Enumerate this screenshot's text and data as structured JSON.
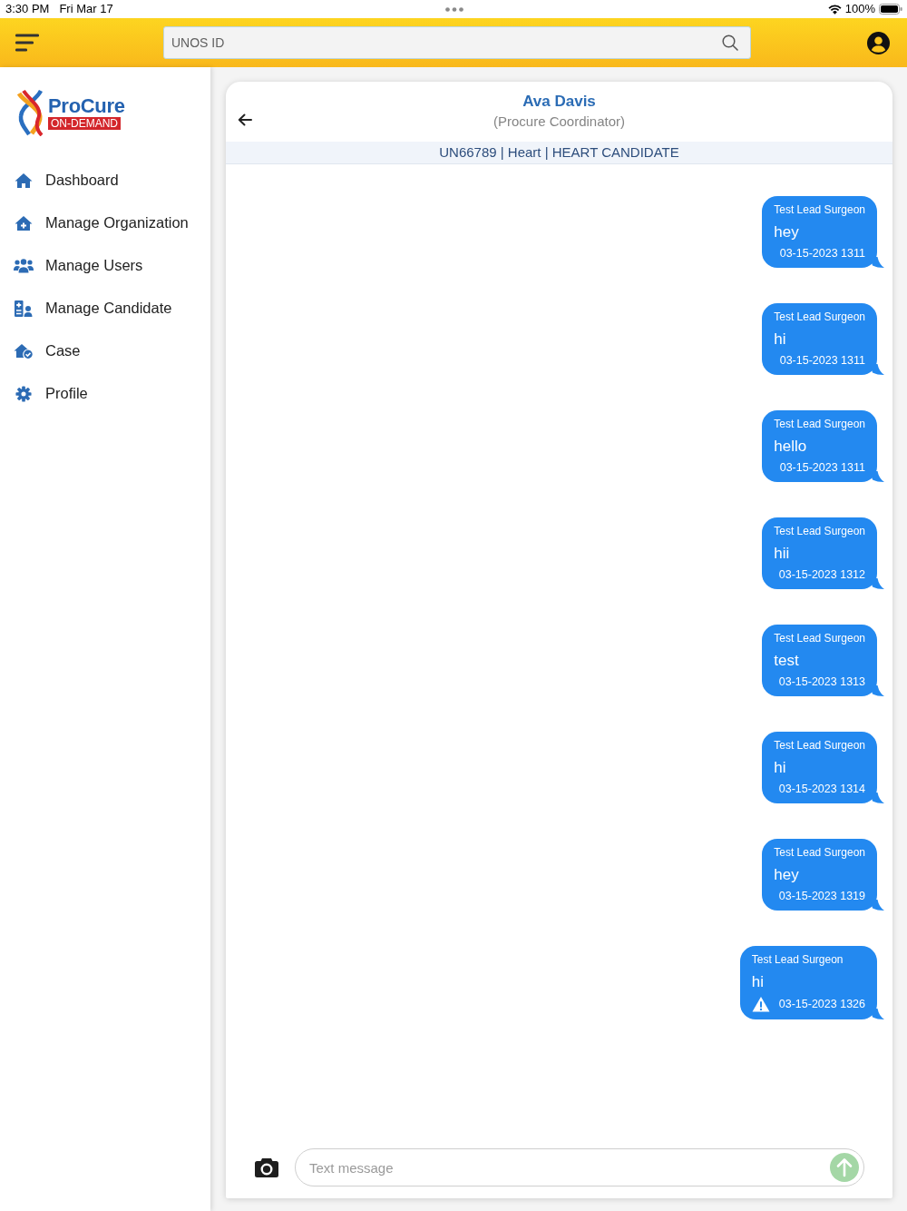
{
  "status_bar": {
    "time": "3:30 PM",
    "date": "Fri Mar 17",
    "battery": "100%"
  },
  "header": {
    "search": {
      "placeholder": "UNOS ID"
    }
  },
  "sidebar": {
    "logo": {
      "name": "ProCure",
      "tagline": "ON-DEMAND"
    },
    "items": [
      {
        "label": "Dashboard"
      },
      {
        "label": "Manage Organization"
      },
      {
        "label": "Manage Users"
      },
      {
        "label": "Manage Candidate"
      },
      {
        "label": "Case"
      },
      {
        "label": "Profile"
      }
    ]
  },
  "chat": {
    "title": "Ava Davis",
    "subtitle": "(Procure Coordinator)",
    "info": "UN66789 | Heart | HEART CANDIDATE",
    "messages": [
      {
        "sender": "Test Lead Surgeon",
        "text": "hey",
        "time": "03-15-2023 1311",
        "failed": false
      },
      {
        "sender": "Test Lead Surgeon",
        "text": "hi",
        "time": "03-15-2023 1311",
        "failed": false
      },
      {
        "sender": "Test Lead Surgeon",
        "text": "hello",
        "time": "03-15-2023 1311",
        "failed": false
      },
      {
        "sender": "Test Lead Surgeon",
        "text": "hii",
        "time": "03-15-2023 1312",
        "failed": false
      },
      {
        "sender": "Test Lead Surgeon",
        "text": "test",
        "time": "03-15-2023 1313",
        "failed": false
      },
      {
        "sender": "Test Lead Surgeon",
        "text": "hi",
        "time": "03-15-2023 1314",
        "failed": false
      },
      {
        "sender": "Test Lead Surgeon",
        "text": "hey",
        "time": "03-15-2023 1319",
        "failed": false
      },
      {
        "sender": "Test Lead Surgeon",
        "text": "hi",
        "time": "03-15-2023 1326",
        "failed": true
      }
    ],
    "compose": {
      "placeholder": "Text message"
    }
  }
}
